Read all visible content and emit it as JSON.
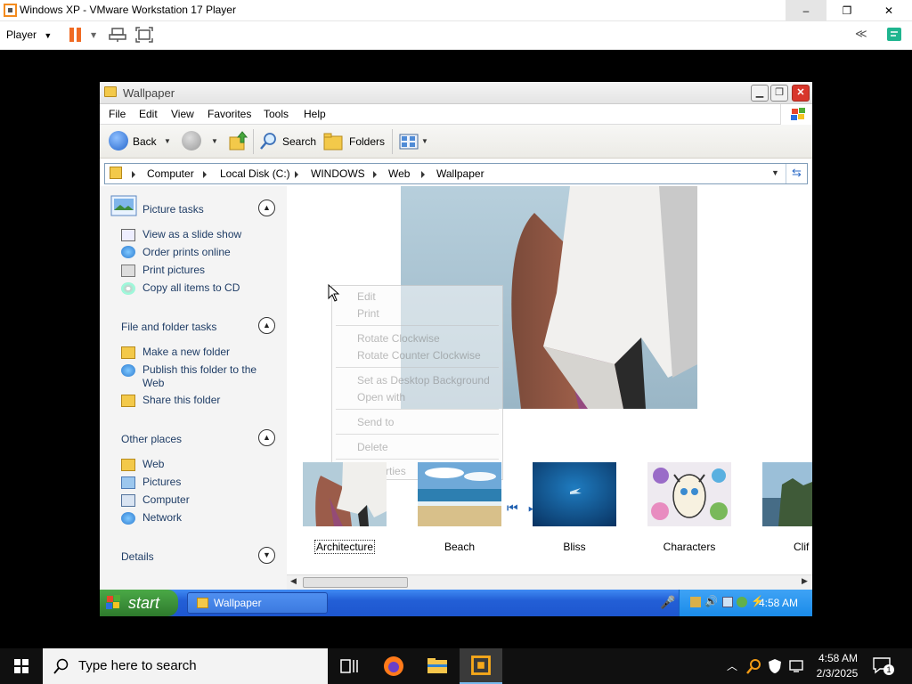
{
  "host_window": {
    "title": "Windows XP - VMware Workstation 17 Player",
    "min_glyph": "–",
    "max_glyph": "❐",
    "close_glyph": "✕",
    "player_menu": "Player",
    "collapse_glyph": "≪"
  },
  "xp_window": {
    "title": "Wallpaper",
    "menu": [
      "File",
      "Edit",
      "View",
      "Favorites",
      "Tools",
      "Help"
    ],
    "toolbar": {
      "back": "Back",
      "search": "Search",
      "folders": "Folders"
    },
    "address": [
      "Computer",
      "Local Disk (C:)",
      "WINDOWS",
      "Web",
      "Wallpaper"
    ]
  },
  "left_panel": {
    "picture_tasks": {
      "title": "Picture tasks",
      "items": [
        "View as a slide show",
        "Order prints online",
        "Print pictures",
        "Copy all items to CD"
      ]
    },
    "file_tasks": {
      "title": "File and folder tasks",
      "items": [
        "Make a new folder",
        "Publish this folder to the Web",
        "Share this folder"
      ]
    },
    "other_places": {
      "title": "Other places",
      "items": [
        "Web",
        "Pictures",
        "Computer",
        "Network"
      ]
    },
    "details": {
      "title": "Details"
    }
  },
  "context_menu": {
    "items": [
      "Edit",
      "Print",
      "Rotate Clockwise",
      "Rotate Counter Clockwise",
      "Set as Desktop Background",
      "Open with",
      "Send to",
      "Delete",
      "Properties"
    ]
  },
  "thumbnails": [
    {
      "label": "Architecture",
      "selected": true
    },
    {
      "label": "Beach"
    },
    {
      "label": "Bliss"
    },
    {
      "label": "Characters"
    },
    {
      "label": "Clif"
    }
  ],
  "xp_taskbar": {
    "start": "start",
    "task_button": "Wallpaper",
    "clock": "4:58 AM"
  },
  "host_taskbar": {
    "search_placeholder": "Type here to search",
    "time": "4:58 AM",
    "date": "2/3/2025",
    "notification_count": "1"
  },
  "colors": {
    "xp_blue": "#235fd6",
    "xp_start_green": "#3a8d38",
    "vmware_orange": "#f06a22",
    "panel_link": "#1f3d66"
  }
}
